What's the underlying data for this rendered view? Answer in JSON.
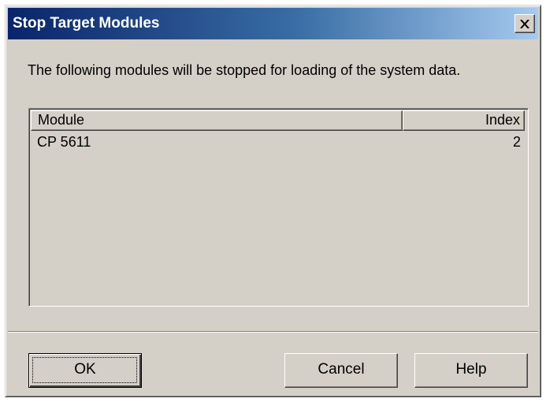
{
  "dialog": {
    "title": "Stop Target Modules",
    "close_icon": "close-x-icon",
    "message": "The following modules will be stopped for loading of the system data."
  },
  "list": {
    "columns": [
      "Module",
      "Index"
    ],
    "rows": [
      {
        "module": "CP 5611",
        "index": "2"
      }
    ]
  },
  "buttons": {
    "ok": "OK",
    "cancel": "Cancel",
    "help": "Help"
  },
  "colors": {
    "titlebar_start": "#0a246a",
    "titlebar_end": "#a6caf0",
    "face": "#d4d0c8"
  }
}
